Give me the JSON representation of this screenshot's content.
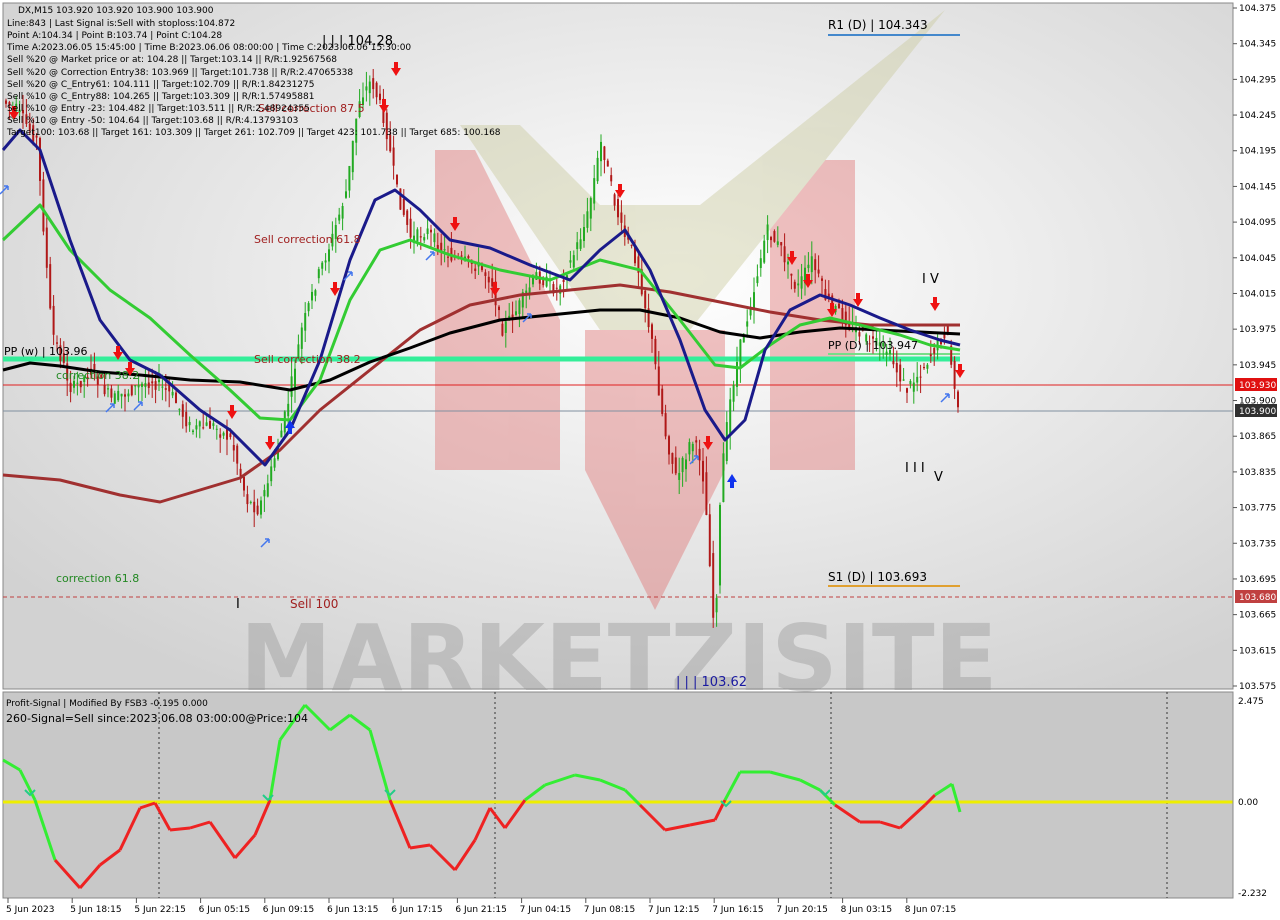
{
  "chart_data": {
    "type": "candlestick",
    "symbol_line": "DX,M15  103.920 103.920 103.900 103.900",
    "info_lines": [
      "Line:843 | Last Signal is:Sell with stoploss:104.872",
      "Point A:104.34 | Point B:103.74 | Point C:104.28",
      "Time A:2023.06.05 15:45:00 | Time B:2023.06.06 08:00:00 | Time C:2023.06.06 15:30:00",
      "Sell %20 @ Market price or at: 104.28 || Target:103.14 || R/R:1.92567568",
      "Sell %20 @ Correction Entry38: 103.969 || Target:101.738 || R/R:2.47065338",
      "Sell %20 @ C_Entry61: 104.111 || Target:102.709 || R/R:1.84231275",
      "Sell %10 @ C_Entry88: 104.265 || Target:103.309 || R/R:1.57495881",
      "Sell %10 @ Entry -23: 104.482 || Target:103.511 || R/R:2.48924355",
      "Sell %10 @ Entry -50: 104.64 || Target:103.68 || R/R:4.13793103",
      "Target100: 103.68 || Target 161: 103.309 || Target 261: 102.709 || Target 423: 101.738 || Target 685: 100.168"
    ],
    "y_ticks": [
      "104.375",
      "104.345",
      "104.295",
      "104.245",
      "104.195",
      "104.145",
      "104.095",
      "104.045",
      "104.015",
      "103.975",
      "103.945",
      "103.900",
      "103.865",
      "103.835",
      "103.775",
      "103.735",
      "103.695",
      "103.665",
      "103.615",
      "103.575"
    ],
    "x_ticks": [
      "5 Jun 2023",
      "5 Jun 18:15",
      "5 Jun 22:15",
      "6 Jun 05:15",
      "6 Jun 09:15",
      "6 Jun 13:15",
      "6 Jun 17:15",
      "6 Jun 21:15",
      "7 Jun 04:15",
      "7 Jun 08:15",
      "7 Jun 12:15",
      "7 Jun 16:15",
      "7 Jun 20:15",
      "8 Jun 03:15",
      "8 Jun 07:15"
    ],
    "price_tags": [
      {
        "label": "103.930",
        "color": "#e01010"
      },
      {
        "label": "103.900",
        "color": "#303030"
      },
      {
        "label": "103.680",
        "color": "#c04040"
      }
    ],
    "annotations": {
      "r1": "R1 (D) | 104.343",
      "s1": "S1 (D) | 103.693",
      "pp_w": "PP (w) | 103.96",
      "pp_d": "PP (D) | 103.947",
      "wave_top": "| | | 104.28",
      "wave_bottom": "| | | 103.62",
      "wave_iv": "I V",
      "wave_iii": "I I I",
      "wave_v": "V",
      "wave_i": "I",
      "sell_corr_875": "Sell correction 87.5",
      "sell_corr_618": "Sell correction 61.8",
      "sell_corr_382": "Sell correction 38.2",
      "corr_618": "correction 61.8",
      "corr_382": "correction 38.2",
      "sell_100": "Sell 100"
    },
    "watermark": "MARKETZISITE",
    "indicator": {
      "title": "Profit-Signal | Modified By FSB3 -0.195 0.000",
      "signal": "260-Signal=Sell since:2023.06.08 03:00:00@Price:104",
      "y_ticks": [
        "2.475",
        "0.00",
        "-2.232"
      ]
    },
    "colors": {
      "bull": "#22aa22",
      "bear": "#b01818",
      "ma_blue": "#1a1a8a",
      "ma_green": "#33cc33",
      "ma_black": "#000000",
      "ma_brown": "#a03030",
      "pp_line": "#33ee99",
      "osc_up": "#33ee33",
      "osc_down": "#ee2222",
      "zero_line": "#eeee00"
    }
  }
}
